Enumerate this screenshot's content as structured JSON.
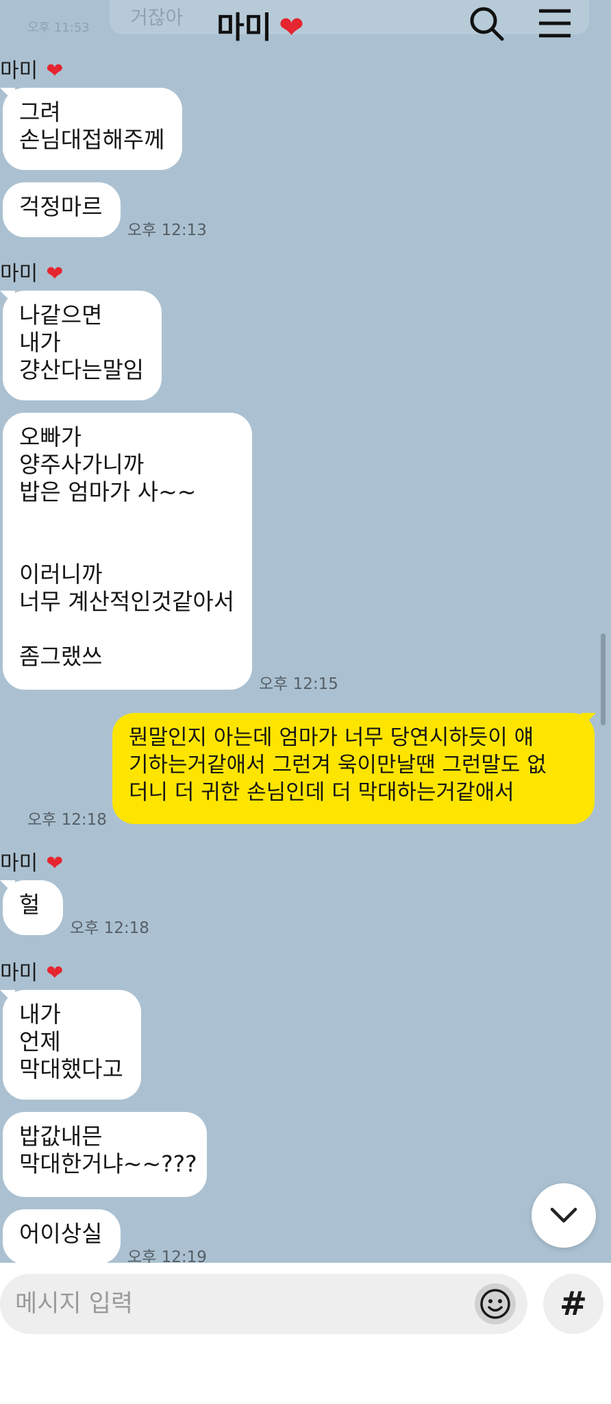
{
  "header": {
    "title": "마미",
    "heart_icon": "❤",
    "behind_time": "오후 11:53",
    "behind_text": "거잖아"
  },
  "messages": [
    {
      "side": "left",
      "sender": "마미",
      "text": "그려\n손님대접해주께"
    },
    {
      "side": "left",
      "text": "걱정마르",
      "time": "오후 12:13"
    },
    {
      "side": "left",
      "sender": "마미",
      "text": "나같으면\n내가\n걍산다는말임"
    },
    {
      "side": "left",
      "text": "오빠가\n양주사가니까\n밥은 엄마가 사~~\n\n\n이러니까\n너무 계산적인것같아서\n\n좀그랬쓰",
      "time": "오후 12:15"
    },
    {
      "side": "right",
      "text": "뭔말인지 아는데 엄마가 너무 당연시하듯이 얘\n기하는거같애서 그런겨 욱이만날땐 그런말도 없\n더니 더 귀한 손님인데 더 막대하는거같애서",
      "time": "오후 12:18"
    },
    {
      "side": "left",
      "sender": "마미",
      "text": "헐",
      "time": "오후 12:18"
    },
    {
      "side": "left",
      "sender": "마미",
      "text": "내가\n언제\n막대했다고"
    },
    {
      "side": "left",
      "text": "밥값내믄\n막대한거냐~~???"
    },
    {
      "side": "left",
      "text": "어이상실",
      "time": "오후 12:19"
    }
  ],
  "input": {
    "placeholder": "메시지 입력"
  },
  "buttons": {
    "hashtag_label": "#"
  },
  "colors": {
    "chat_background": "#abc1d1",
    "my_bubble": "#fee500",
    "their_bubble": "#ffffff",
    "heart": "#e5252f"
  },
  "icons": [
    "search-icon",
    "menu-icon",
    "chevron-down-icon",
    "emoji-icon",
    "hashtag-icon",
    "heart-icon"
  ]
}
